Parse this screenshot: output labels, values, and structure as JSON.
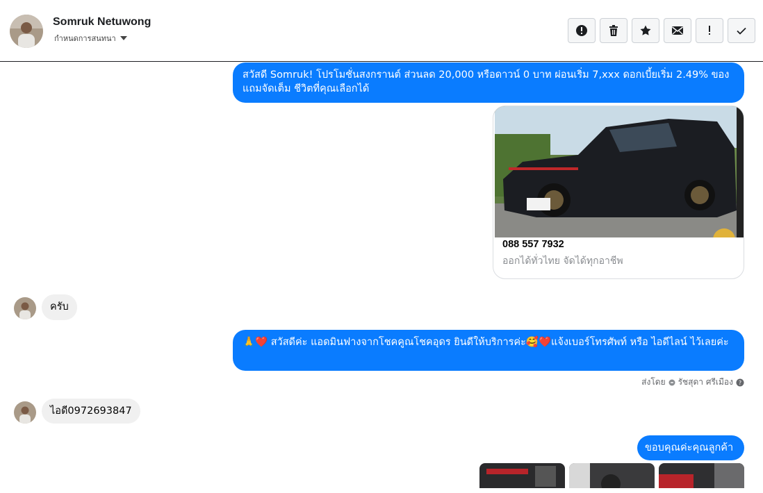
{
  "header": {
    "name": "Somruk Netuwong",
    "status": "กำหนดการสนทนา",
    "actions": [
      {
        "icon": "alert-circle-icon"
      },
      {
        "icon": "trash-icon"
      },
      {
        "icon": "star-icon"
      },
      {
        "icon": "envelope-icon"
      },
      {
        "icon": "exclamation-icon"
      },
      {
        "icon": "check-icon"
      }
    ]
  },
  "messages": {
    "m1": "สวัสดี Somruk! โปรโมชั่นสงกรานต์ ส่วนลด 20,000 หรือดาวน์ 0 บาท ผ่อนเริ่ม 7,xxx ดอกเบี้ยเริ่ม 2.49% ของแถมจัดเต็ม ชีวิตที่คุณเลือกได้",
    "card_title": "088 557 7932",
    "card_subtitle": "ออกได้ทั่วไทย จัดได้ทุกอาชีพ",
    "m2": "ครับ",
    "m3": "🙏❤️ สวัสดีค่ะ แอดมินฟางจากโชคคูณโชคอุดร ยินดีให้บริการค่ะ🥰❤️แจ้งเบอร์โทรศัพท์ หรือ ไอดีไลน์  ไว้เลยค่ะ",
    "sent_by_prefix": "ส่งโดย",
    "sent_by_name": "รัชสุดา ศรีเมือง",
    "m4": "ไอดี0972693847",
    "m5": "ขอบคุณค่ะคุณลูกค้า"
  },
  "colors": {
    "outgoing": "#0a7cff",
    "incoming": "#f0f0f0"
  }
}
